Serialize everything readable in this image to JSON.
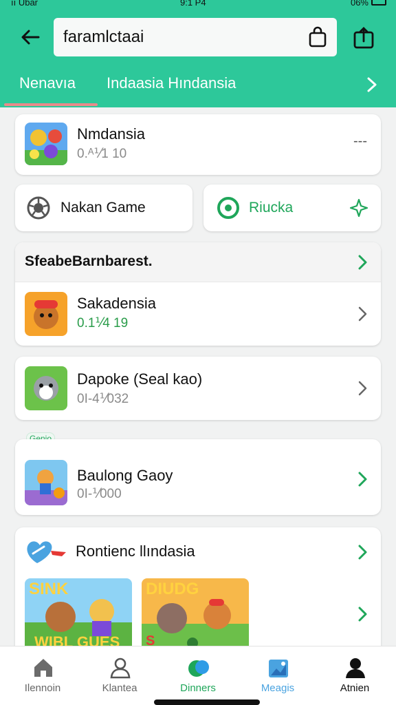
{
  "status": {
    "carrier": "ıı Ubar",
    "time": "9:1 P4",
    "battery": "06%"
  },
  "search": {
    "value": "faramlctaai"
  },
  "tabs": [
    "Nenavıa",
    "Indaasia Hındansia"
  ],
  "top_card": {
    "title": "Nmdansia",
    "subtitle": "0.ᴬ⅟1 10",
    "more": "---"
  },
  "buttons": {
    "left": "Nakan Game",
    "right": "Riucka"
  },
  "section": {
    "header": "SfeabeBarnbarest.",
    "items": [
      {
        "title": "Sakadensia",
        "subtitle": "0.1⅟4 19"
      },
      {
        "title": "Dapoke (Seal kao)",
        "subtitle": "0I-4⅟032"
      }
    ]
  },
  "badge": "Genio",
  "game_card": {
    "title": "Baulong Gaoy",
    "subtitle": "0I-⅟000"
  },
  "rec_card": {
    "title": "Rontienc llındasia",
    "thumb1_text": [
      "SINK",
      "WIBL GUES"
    ],
    "thumb2_text": [
      "DIUDG",
      "S"
    ]
  },
  "nav": [
    {
      "label": "Ilennoin",
      "icon": "home-icon"
    },
    {
      "label": "Klantea",
      "icon": "person-icon"
    },
    {
      "label": "Dinners",
      "icon": "games-icon",
      "active": true
    },
    {
      "label": "Meagis",
      "icon": "image-icon"
    },
    {
      "label": "Atnien",
      "icon": "account-icon"
    }
  ],
  "colors": {
    "primary": "#2dc89a",
    "accent": "#1fa65a",
    "indicator": "#e98b8b"
  }
}
